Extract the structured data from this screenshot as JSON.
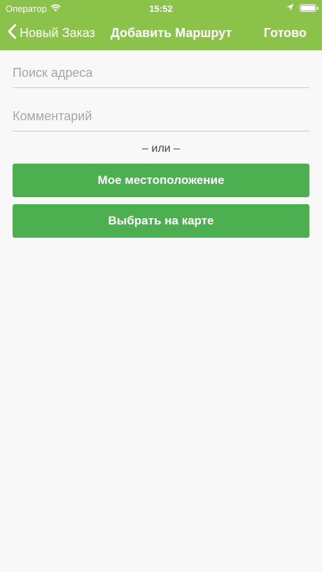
{
  "status_bar": {
    "carrier": "Оператор",
    "time": "15:52",
    "battery_level": 1.0,
    "icons": [
      "wifi-icon",
      "location-arrow-icon",
      "battery-icon"
    ]
  },
  "nav": {
    "back_label": "Новый Заказ",
    "title": "Добавить Маршрут",
    "done_label": "Готово"
  },
  "form": {
    "address_placeholder": "Поиск адреса",
    "address_value": "",
    "comment_placeholder": "Комментарий",
    "comment_value": ""
  },
  "separator": "– или –",
  "buttons": {
    "my_location": "Мое местоположение",
    "pick_on_map": "Выбрать на карте"
  },
  "colors": {
    "header_bg": "#8bc34a",
    "button_bg": "#4caf50",
    "page_bg": "#f8f8f8"
  }
}
